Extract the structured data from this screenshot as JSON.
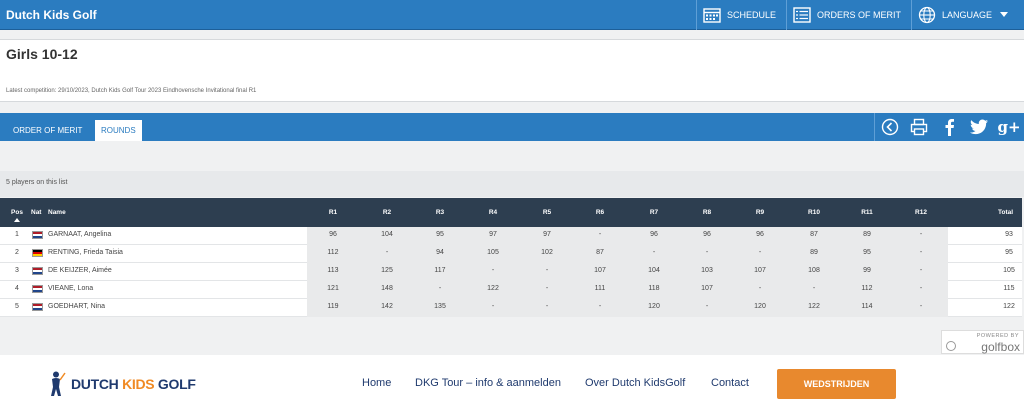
{
  "header": {
    "brand": "Dutch Kids Golf",
    "nav": [
      {
        "label": "SCHEDULE",
        "icon": "calendar-icon"
      },
      {
        "label": "ORDERS OF MERIT",
        "icon": "list-icon"
      },
      {
        "label": "LANGUAGE",
        "icon": "globe-icon"
      }
    ]
  },
  "page": {
    "title": "Girls 10-12",
    "latest_competition": "Latest competition: 29/10/2023, Dutch Kids Golf Tour 2023 Eindhovensche Invitational final R1"
  },
  "tabs": [
    "ORDER OF MERIT",
    "ROUNDS"
  ],
  "active_tab": "ROUNDS",
  "toolbar_icons": [
    "back-icon",
    "print-icon",
    "facebook-icon",
    "twitter-icon",
    "google-plus-icon"
  ],
  "google_plus_label": "g+",
  "players_count": "5 players on this list",
  "table": {
    "headers": {
      "pos": "Pos",
      "nat": "Nat",
      "name": "Name",
      "rounds": [
        "R1",
        "R2",
        "R3",
        "R4",
        "R5",
        "R6",
        "R7",
        "R8",
        "R9",
        "R10",
        "R11",
        "R12"
      ],
      "total": "Total"
    },
    "rows": [
      {
        "pos": "1",
        "flag": "NED",
        "name": "GARNAAT, Angelina",
        "rounds": [
          "96",
          "104",
          "95",
          "97",
          "97",
          "-",
          "96",
          "96",
          "96",
          "87",
          "89",
          "-"
        ],
        "total": "93"
      },
      {
        "pos": "2",
        "flag": "GER",
        "name": "RENTING, Frieda Taisia",
        "rounds": [
          "112",
          "-",
          "94",
          "105",
          "102",
          "87",
          "-",
          "-",
          "-",
          "89",
          "95",
          "-"
        ],
        "total": "95"
      },
      {
        "pos": "3",
        "flag": "NED",
        "name": "DE KEIJZER, Aimée",
        "rounds": [
          "113",
          "125",
          "117",
          "-",
          "-",
          "107",
          "104",
          "103",
          "107",
          "108",
          "99",
          "-"
        ],
        "total": "105"
      },
      {
        "pos": "4",
        "flag": "NED",
        "name": "VIEANE, Lona",
        "rounds": [
          "121",
          "148",
          "-",
          "122",
          "-",
          "111",
          "118",
          "107",
          "-",
          "-",
          "112",
          "-"
        ],
        "total": "115"
      },
      {
        "pos": "5",
        "flag": "NED",
        "name": "GOEDHART, Nina",
        "rounds": [
          "119",
          "142",
          "135",
          "-",
          "-",
          "-",
          "120",
          "-",
          "120",
          "122",
          "114",
          "-"
        ],
        "total": "122"
      }
    ]
  },
  "flags": {
    "NED": [
      "#ae1c28",
      "#ffffff",
      "#21468b"
    ],
    "GER": [
      "#000000",
      "#dd0000",
      "#ffce00"
    ]
  },
  "powered_by": {
    "label": "POWERED BY",
    "brand": "golfbox"
  },
  "footer": {
    "logo_text_1": "DUTCH ",
    "logo_text_2": "KIDS",
    "logo_text_3": " GOLF",
    "nav": [
      "Home",
      "DKG Tour – info & aanmelden",
      "Over Dutch KidsGolf",
      "Contact"
    ],
    "cta": "WEDSTRIJDEN"
  },
  "colors": {
    "primary": "#2b7cc0",
    "table_header": "#2d3e50",
    "accent": "#e8892e",
    "navy": "#1f3a6e"
  }
}
